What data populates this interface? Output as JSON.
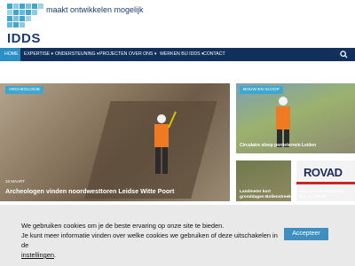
{
  "header": {
    "logo_text": "IDDS",
    "tagline": "maakt ontwikkelen mogelijk"
  },
  "nav": {
    "items": [
      {
        "label": "HOME",
        "active": true
      },
      {
        "label": "EXPERTISE ▾"
      },
      {
        "label": "ONDERSTEUNING ▾"
      },
      {
        "label": "PROJECTEN"
      },
      {
        "label": "OVER ONS ▾"
      },
      {
        "label": "WERKEN BIJ IDDS ▾"
      },
      {
        "label": "CONTACT"
      }
    ],
    "search_icon": "search-icon"
  },
  "hero": {
    "badge": "ARCHEOLOGIE",
    "date": "19 MAART",
    "title": "Archeologen vinden noordwesttoren Leidse Witte Poort"
  },
  "side_articles": [
    {
      "badge": "BOUW EN SLOOP",
      "title": "Circulaire sloop perrieterrein Leiden"
    },
    {
      "title": "Landmeter kort gronddagen Bollenstreek"
    },
    {
      "logo": "ROVAD",
      "title": "Kom je naar ROVADIK – Hal 12, stand"
    }
  ],
  "cookie": {
    "line1": "We gebruiken cookies om je de beste ervaring op onze site te bieden.",
    "line2": "Je kunt meer informatie vinden over welke cookies we gebruiken of deze uitschakelen in de",
    "link": "instellingen",
    "end": ".",
    "accept_label": "Accepteer"
  },
  "colors": {
    "nav_bg": "#12305c",
    "accent": "#3fa7cf",
    "accept_button": "#3e8fbf"
  }
}
